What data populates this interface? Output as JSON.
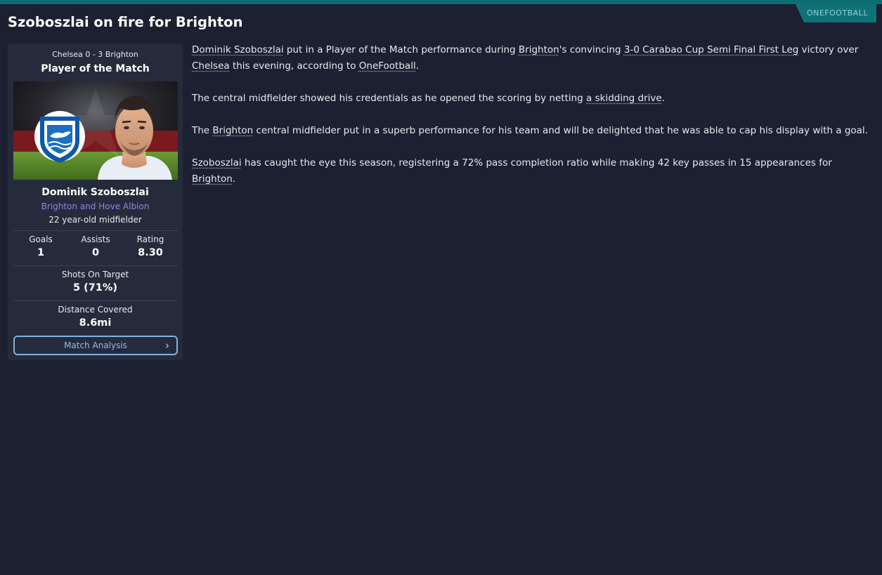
{
  "source": "ONEFOOTBALL",
  "headline": "Szoboszlai on fire for Brighton",
  "card": {
    "match_score": "Chelsea 0 - 3 Brighton",
    "title": "Player of the Match",
    "player_name": "Dominik Szoboszlai",
    "club": "Brighton and Hove Albion",
    "description": "22 year-old midfielder",
    "stats": [
      {
        "label": "Goals",
        "value": "1"
      },
      {
        "label": "Assists",
        "value": "0"
      },
      {
        "label": "Rating",
        "value": "8.30"
      }
    ],
    "shots_label": "Shots On Target",
    "shots_value": "5 (71%)",
    "distance_label": "Distance Covered",
    "distance_value": "8.6mi",
    "button_label": "Match Analysis",
    "club_color": "#8c86e6"
  },
  "article": {
    "p1": {
      "t1": "Dominik Szoboszlai",
      "t2": " put in a Player of the Match performance during ",
      "t3": "Brighton",
      "t4": "'s convincing ",
      "t5": "3-0 Carabao Cup Semi Final First Leg",
      "t6": " victory over ",
      "t7": "Chelsea",
      "t8": " this evening, according to ",
      "t9": "OneFootball",
      "t10": "."
    },
    "p2": {
      "t1": "The central midfielder showed his credentials as he opened the scoring by netting ",
      "t2": "a skidding drive",
      "t3": "."
    },
    "p3": {
      "t1": "The ",
      "t2": "Brighton",
      "t3": " central midfielder put in a superb performance for his team and will be delighted that he was able to cap his display with a goal."
    },
    "p4": {
      "t1": "Szoboszlai",
      "t2": " has caught the eye this season, registering a 72% pass completion ratio while making 42 key passes in 15 appearances for ",
      "t3": "Brighton",
      "t4": "."
    }
  },
  "colors": {
    "accent_teal": "#0d6d72",
    "background": "#1c2030",
    "card": "#262b3b",
    "button_border": "#7fb3e0"
  }
}
